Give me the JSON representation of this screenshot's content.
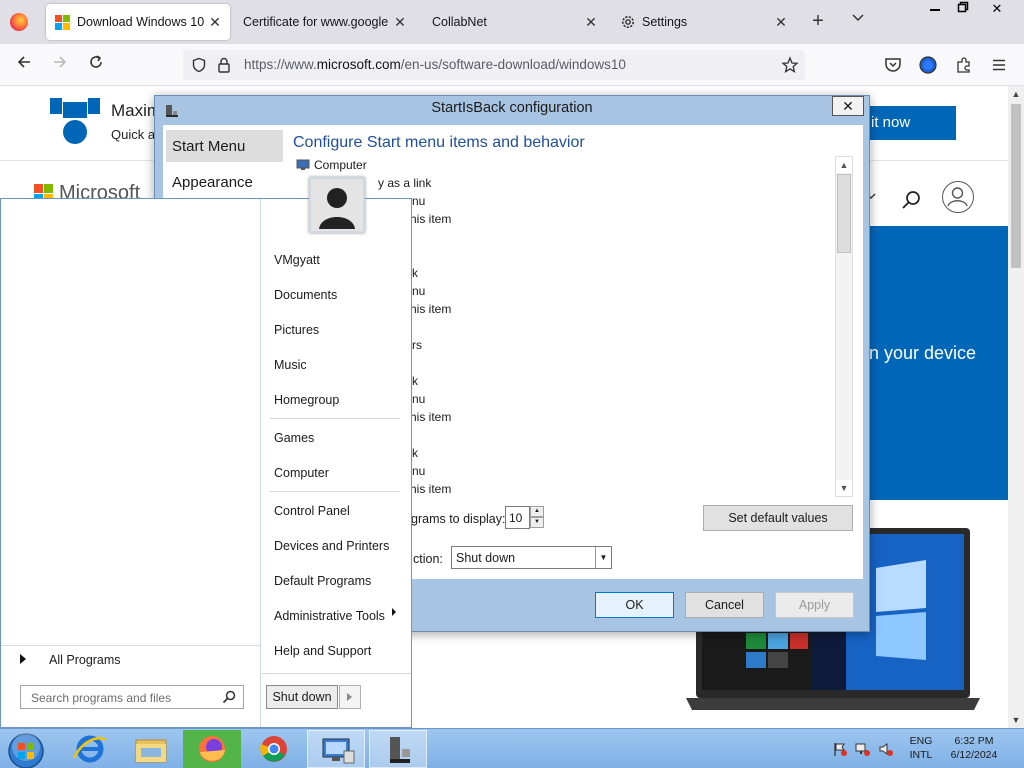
{
  "browser": {
    "tabs": [
      {
        "label": "Download Windows 10",
        "active": true
      },
      {
        "label": "Certificate for www.google.c",
        "active": false
      },
      {
        "label": "CollabNet",
        "active": false
      },
      {
        "label": "Settings",
        "active": false
      }
    ],
    "url_prefix": "https://www.",
    "url_domain": "microsoft.com",
    "url_path": "/en-us/software-download/windows10",
    "tab_close_glyph": "✕",
    "new_tab_glyph": "+"
  },
  "page": {
    "title_partial": "Maxim",
    "sub_partial": "Quick a",
    "brand": "Microsoft",
    "hero_button_partial": "it now",
    "blue_text_partial": "n your device"
  },
  "dialog": {
    "title": "StartIsBack configuration",
    "close_glyph": "✕",
    "nav": [
      "Start Menu",
      "Appearance"
    ],
    "heading": "Configure Start menu items and behavior",
    "tree": [
      {
        "text": "Computer"
      },
      {
        "text": "y as a link"
      },
      {
        "text": "nu"
      },
      {
        "text": "his item"
      },
      {
        "text": "k"
      },
      {
        "text": "nu"
      },
      {
        "text": "his item"
      },
      {
        "text": "rs"
      },
      {
        "text": "k"
      },
      {
        "text": "nu"
      },
      {
        "text": "his item"
      },
      {
        "text": "k"
      },
      {
        "text": "nu"
      },
      {
        "text": "his item"
      }
    ],
    "programs_label_partial": "grams to display:",
    "programs_value": "10",
    "set_default_label": "Set default values",
    "action_label_partial": "ction:",
    "action_value": "Shut down",
    "ok_label": "OK",
    "cancel_label": "Cancel",
    "apply_label": "Apply"
  },
  "start_menu": {
    "right_items": [
      "VMgyatt",
      "Documents",
      "Pictures",
      "Music",
      "Homegroup",
      "Games",
      "Computer",
      "Control Panel",
      "Devices and Printers",
      "Default Programs",
      "Administrative Tools",
      "Help and Support"
    ],
    "all_programs": "All Programs",
    "search_placeholder": "Search programs and files",
    "shutdown_label": "Shut down"
  },
  "taskbar": {
    "lang_top": "ENG",
    "lang_bottom": "INTL",
    "time": "6:32 PM",
    "date": "6/12/2024"
  },
  "colors": {
    "accent": "#0067b8",
    "dialog_frame": "#a7c4e2",
    "taskbar": "#8dbbeb",
    "firefox_active": "#53b44a"
  }
}
